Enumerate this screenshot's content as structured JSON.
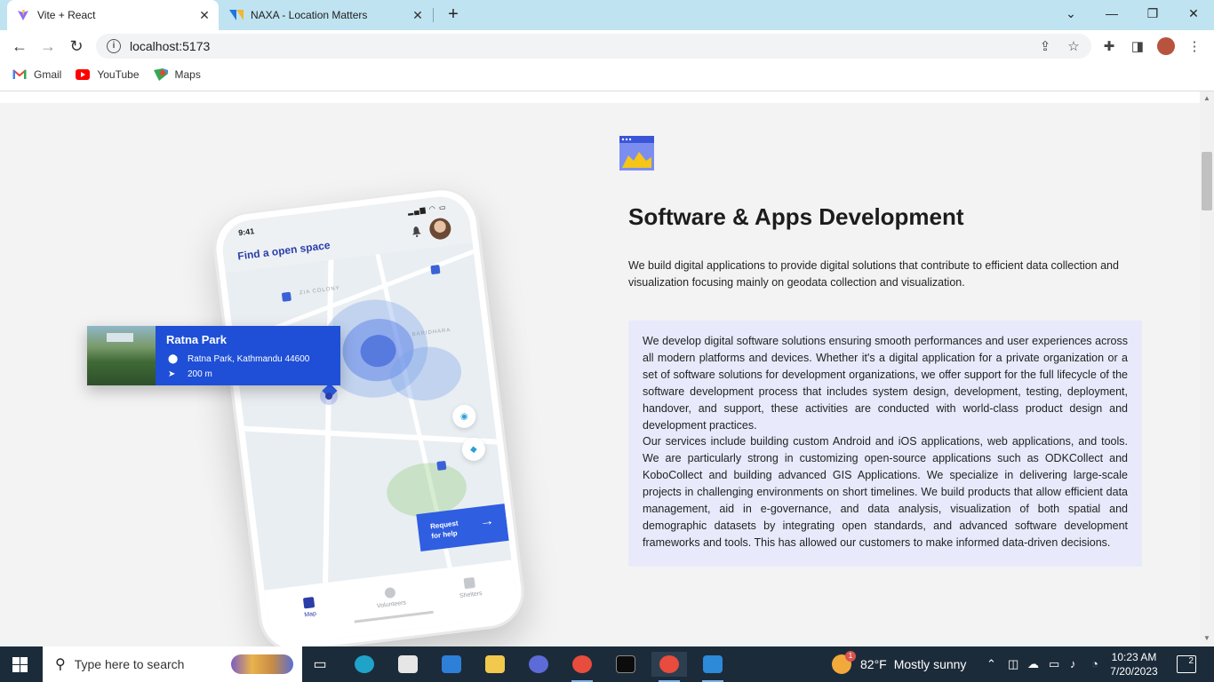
{
  "browser": {
    "tabs": [
      {
        "title": "Vite + React",
        "favicon": "vite-icon",
        "active": true
      },
      {
        "title": "NAXA - Location Matters",
        "favicon": "naxa-icon",
        "active": false
      }
    ],
    "url": "localhost:5173",
    "bookmarks": [
      {
        "label": "Gmail",
        "icon": "gmail-icon"
      },
      {
        "label": "YouTube",
        "icon": "youtube-icon"
      },
      {
        "label": "Maps",
        "icon": "maps-icon"
      }
    ]
  },
  "phone": {
    "time": "9:41",
    "header": "Find a open space",
    "request_label_1": "Request",
    "request_label_2": "for help",
    "nav": [
      "Map",
      "Volunteers",
      "Shelters"
    ]
  },
  "card": {
    "name": "Ratna Park",
    "address": "Ratna Park, Kathmandu 44600",
    "distance": "200 m"
  },
  "section": {
    "heading": "Software & Apps Development",
    "lead": "We build digital applications to provide digital solutions that contribute to efficient data collection and visualization focusing mainly on geodata collection and visualization.",
    "para1": "We develop digital software solutions ensuring smooth performances and user experiences across all modern platforms and devices. Whether it's a digital application for a private organization or a set of software solutions for development organizations, we offer support for the full lifecycle of the software development process that includes system design, development, testing, deployment, handover, and support, these activities are conducted with world-class product design and development practices.",
    "para2": "Our services include building custom Android and iOS applications, web applications, and tools. We are particularly strong in customizing open-source applications such as ODKCollect and KoboCollect and building advanced GIS Applications. We specialize in delivering large-scale projects in challenging environments on short timelines. We build products that allow efficient data management, aid in e-governance, and data analysis, visualization of both spatial and demographic datasets by integrating open standards, and advanced software development frameworks and tools. This has allowed our customers to make informed data-driven decisions."
  },
  "taskbar": {
    "search_placeholder": "Type here to search",
    "weather_temp": "82°F",
    "weather_text": "Mostly sunny",
    "weather_alert": "1",
    "time": "10:23 AM",
    "date": "7/20/2023",
    "notifications": "2"
  },
  "colors": {
    "accent_blue": "#1e4fd6",
    "infobox_bg": "#e8eafb",
    "page_bg": "#f3f3f3",
    "titlebar_bg": "#bfe3f0"
  }
}
